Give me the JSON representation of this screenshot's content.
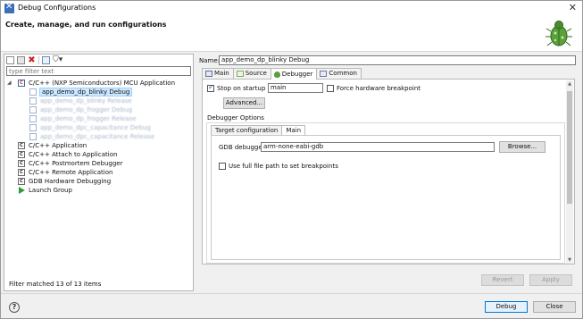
{
  "window": {
    "title": "Debug Configurations",
    "close_label": "✕"
  },
  "header": {
    "title": "Create, manage, and run configurations",
    "icon": "bug-icon"
  },
  "left": {
    "toolbar": [
      {
        "name": "new-config-icon"
      },
      {
        "name": "duplicate-config-icon"
      },
      {
        "name": "delete-config-icon",
        "glyph": "✖"
      },
      {
        "name": "collapse-all-icon"
      },
      {
        "name": "filter-icon",
        "glyph": "⛉▾"
      }
    ],
    "filter_placeholder": "type filter text",
    "tree": [
      {
        "twisty": "◢",
        "icon": "C",
        "label": "C/C++ (NXP Semiconductors) MCU Application"
      },
      {
        "label": "app_demo_dp_blinky Debug",
        "selected": true
      },
      {
        "label": "app_demo_dp_blinky Release",
        "blurred": true
      },
      {
        "label": "app_demo_dp_frogger Debug",
        "blurred": true
      },
      {
        "label": "app_demo_dp_frogger Release",
        "blurred": true
      },
      {
        "label": "app_demo_dpc_capacitance Debug",
        "blurred": true
      },
      {
        "label": "app_demo_dpc_capacitance Release",
        "blurred": true
      },
      {
        "icon": "C",
        "label": "C/C++ Application"
      },
      {
        "icon": "C",
        "label": "C/C++ Attach to Application"
      },
      {
        "icon": "C",
        "label": "C/C++ Postmortem Debugger"
      },
      {
        "icon": "C",
        "label": "C/C++ Remote Application"
      },
      {
        "icon": "C",
        "label": "GDB Hardware Debugging"
      },
      {
        "icon": "play",
        "label": "Launch Group"
      }
    ],
    "status": "Filter matched 13 of 13 items"
  },
  "right": {
    "name_label": "Name:",
    "name_value": "app_demo_dp_blinky Debug",
    "tabs": [
      "Main",
      "Source",
      "Debugger",
      "Common"
    ],
    "active_tab": "Debugger",
    "stop_on_startup_label": "Stop on startup at:",
    "stop_on_startup_value": "main",
    "force_hw_breakpoint_label": "Force hardware breakpoint",
    "advanced_button": "Advanced...",
    "debugger_options_label": "Debugger Options",
    "inner_tabs": [
      "Target configuration",
      "Main"
    ],
    "gdb_label": "GDB debugger:",
    "gdb_value": "arm-none-eabi-gdb",
    "browse_button": "Browse...",
    "full_path_label": "Use full file path to set breakpoints",
    "revert_button": "Revert",
    "apply_button": "Apply"
  },
  "footer": {
    "help": "?",
    "debug_button": "Debug",
    "close_button": "Close"
  }
}
